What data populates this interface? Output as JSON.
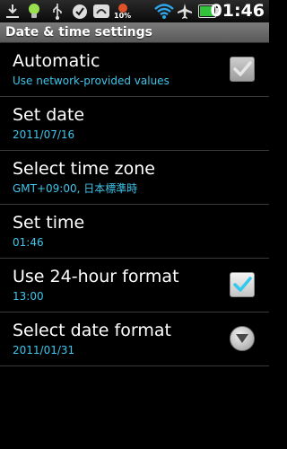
{
  "status_bar": {
    "battery_percent": "10%",
    "time": "01:46",
    "icons": [
      "download-icon",
      "bulb-icon",
      "usb-icon",
      "check-icon",
      "app-icon",
      "battery-alert-icon",
      "wifi-icon",
      "airplane-icon",
      "battery-icon"
    ],
    "colors": {
      "wifi": "#2fa6ea",
      "battery": "#33c23b"
    }
  },
  "title_bar": {
    "title": "Date & time settings"
  },
  "settings": [
    {
      "title": "Automatic",
      "summary": "Use network-provided values",
      "widget": "checkbox",
      "checked": true,
      "enabled": false
    },
    {
      "title": "Set date",
      "summary": "2011/07/16",
      "widget": "none"
    },
    {
      "title": "Select time zone",
      "summary": "GMT+09:00, 日本標準時",
      "widget": "none"
    },
    {
      "title": "Set time",
      "summary": "01:46",
      "widget": "none"
    },
    {
      "title": "Use 24-hour format",
      "summary": "13:00",
      "widget": "checkbox",
      "checked": true,
      "enabled": true
    },
    {
      "title": "Select date format",
      "summary": "2011/01/31",
      "widget": "dropdown"
    }
  ],
  "colors": {
    "summary_text": "#3fc6ec",
    "checkmark": "#31c9ee",
    "checkmark_disabled": "#e6e6e6"
  }
}
